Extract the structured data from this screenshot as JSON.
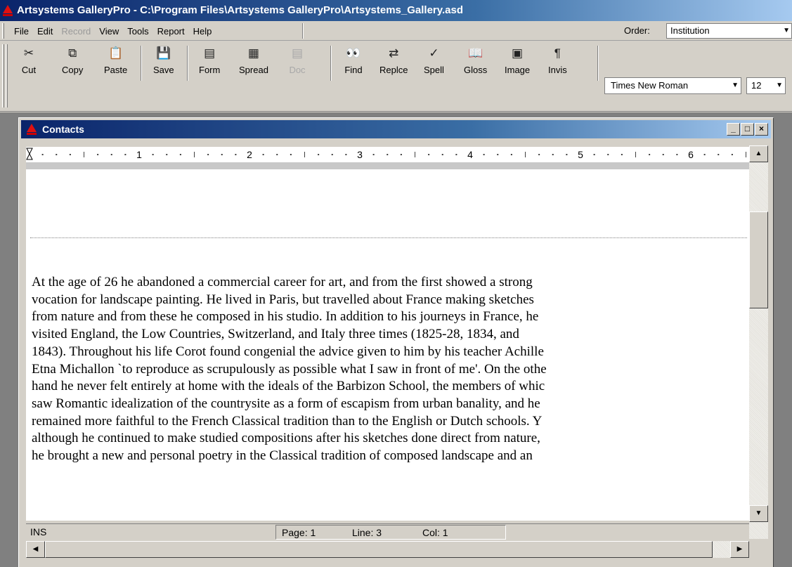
{
  "app": {
    "title": "Artsystems GalleryPro - C:\\Program Files\\Artsystems GalleryPro\\Artsystems_Gallery.asd"
  },
  "menu": {
    "items": [
      {
        "label": "File",
        "enabled": true
      },
      {
        "label": "Edit",
        "enabled": true
      },
      {
        "label": "Record",
        "enabled": false
      },
      {
        "label": "View",
        "enabled": true
      },
      {
        "label": "Tools",
        "enabled": true
      },
      {
        "label": "Report",
        "enabled": true
      },
      {
        "label": "Help",
        "enabled": true
      }
    ],
    "order_label": "Order:",
    "order_value": "Institution"
  },
  "toolbar": {
    "buttons": [
      {
        "label": "Cut",
        "icon": "scissors-icon",
        "glyph": "✂",
        "enabled": true
      },
      {
        "label": "Copy",
        "icon": "copy-icon",
        "glyph": "⧉",
        "enabled": true
      },
      {
        "label": "Paste",
        "icon": "paste-icon",
        "glyph": "📋",
        "enabled": true
      },
      {
        "label": "Save",
        "icon": "floppy-disk-icon",
        "glyph": "💾",
        "enabled": true
      },
      {
        "label": "Form",
        "icon": "form-view-icon",
        "glyph": "▤",
        "enabled": true
      },
      {
        "label": "Spread",
        "icon": "spreadsheet-icon",
        "glyph": "▦",
        "enabled": true
      },
      {
        "label": "Doc",
        "icon": "document-icon",
        "glyph": "▤",
        "enabled": false
      },
      {
        "label": "Find",
        "icon": "binoculars-icon",
        "glyph": "👀",
        "enabled": true
      },
      {
        "label": "Replce",
        "icon": "replace-icon",
        "glyph": "⇄",
        "enabled": true
      },
      {
        "label": "Spell",
        "icon": "spellcheck-icon",
        "glyph": "✓",
        "enabled": true
      },
      {
        "label": "Gloss",
        "icon": "glossary-book-icon",
        "glyph": "📖",
        "enabled": true
      },
      {
        "label": "Image",
        "icon": "image-icon",
        "glyph": "▣",
        "enabled": true
      },
      {
        "label": "Invis",
        "icon": "pilcrow-icon",
        "glyph": "¶",
        "enabled": true
      }
    ],
    "font": "Times New Roman",
    "size": "12"
  },
  "window": {
    "title": "Contacts",
    "controls": [
      "_",
      "□",
      "×"
    ]
  },
  "ruler": {
    "numbers": [
      "1",
      "2",
      "3",
      "4",
      "5",
      "6"
    ]
  },
  "document": {
    "lines": [
      "At the age of 26 he abandoned a commercial career for art, and from the first showed a strong",
      "vocation for landscape painting. He lived in Paris, but travelled about France making sketches",
      "from nature and from these he composed in his studio. In addition to his journeys in France, he",
      "visited England, the Low Countries, Switzerland, and Italy three times (1825-28, 1834, and",
      "1843). Throughout his life Corot found congenial the advice given to him by his teacher Achille",
      "Etna Michallon `to reproduce as scrupulously as possible what I saw in front of me'. On the othe",
      "hand he never felt entirely at home with the ideals of the Barbizon School, the members of whic",
      "saw Romantic idealization of the countrysite as a form of escapism from urban banality, and he",
      "remained more faithful to the French Classical tradition than to the English or Dutch schools. Y",
      "although he continued to make studied compositions after his sketches done direct from nature,",
      "he brought a new and personal poetry in the Classical tradition of composed landscape and an"
    ]
  },
  "status": {
    "mode": "INS",
    "page": "Page: 1",
    "line": "Line: 3",
    "col": "Col: 1"
  }
}
